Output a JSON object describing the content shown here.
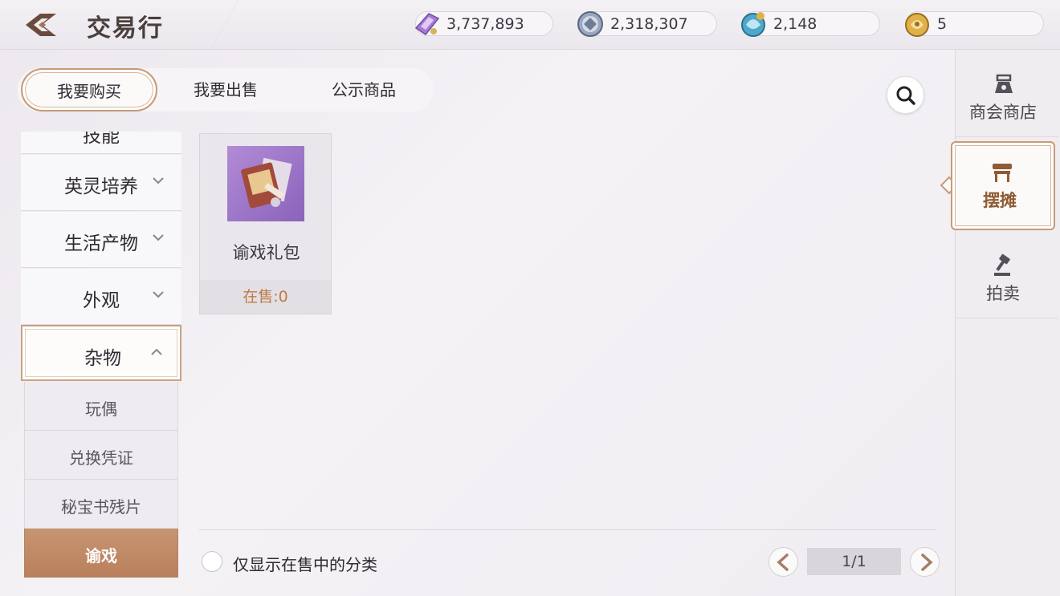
{
  "header": {
    "title": "交易行",
    "currencies": [
      {
        "icon": "crystal-currency-icon",
        "value": "3,737,893"
      },
      {
        "icon": "silver-coin-icon",
        "value": "2,318,307"
      },
      {
        "icon": "dragon-token-icon",
        "value": "2,148"
      },
      {
        "icon": "gold-dragon-icon",
        "value": "5"
      }
    ]
  },
  "tabs": [
    {
      "label": "我要购买",
      "active": true
    },
    {
      "label": "我要出售",
      "active": false
    },
    {
      "label": "公示商品",
      "active": false
    }
  ],
  "categories": {
    "partial_top": "技能",
    "items": [
      {
        "label": "英灵培养",
        "expanded": false
      },
      {
        "label": "生活产物",
        "expanded": false
      },
      {
        "label": "外观",
        "expanded": false
      },
      {
        "label": "杂物",
        "expanded": true
      }
    ],
    "sub_items": [
      {
        "label": "玩偶",
        "active": false
      },
      {
        "label": "兑换凭证",
        "active": false
      },
      {
        "label": "秘宝书残片",
        "active": false
      },
      {
        "label": "谕戏",
        "active": true
      }
    ]
  },
  "items": [
    {
      "name": "谕戏礼包",
      "on_sale": "在售:0"
    }
  ],
  "footer": {
    "filter_label": "仅显示在售中的分类",
    "filter_checked": false,
    "page": "1/1"
  },
  "right_nav": [
    {
      "label": "商会商店",
      "icon": "guild-shop-icon",
      "active": false
    },
    {
      "label": "摆摊",
      "icon": "stall-icon",
      "active": true
    },
    {
      "label": "拍卖",
      "icon": "auction-gavel-icon",
      "active": false
    }
  ],
  "colors": {
    "accent": "#c89a76",
    "active_sub": "#c08a65",
    "sale_text": "#c07a46"
  }
}
